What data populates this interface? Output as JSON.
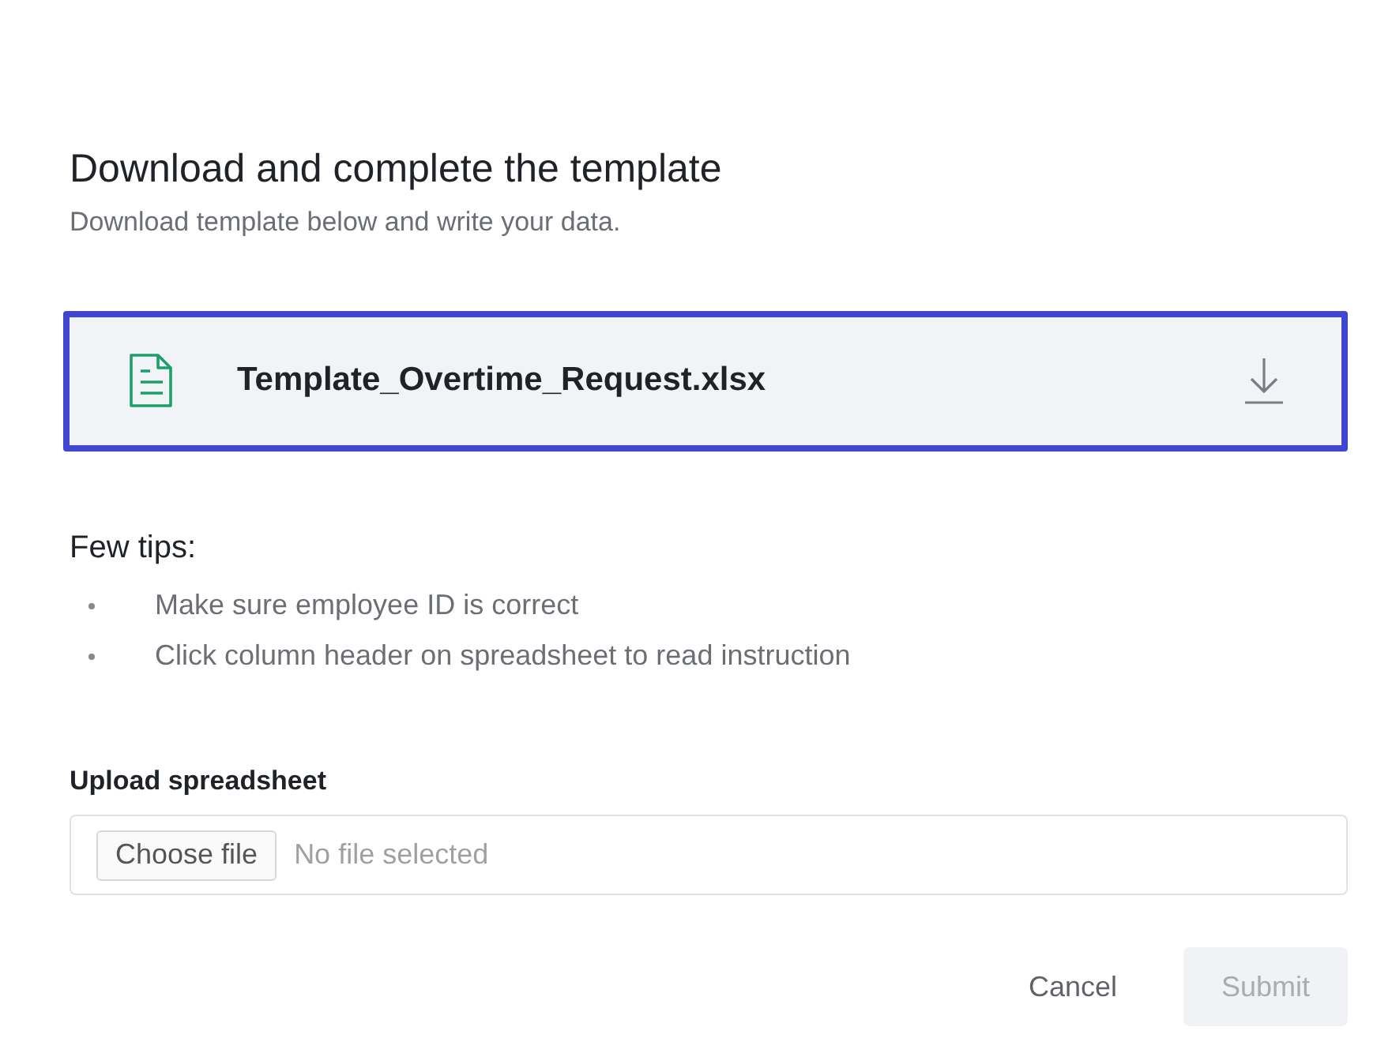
{
  "heading": "Download and complete the template",
  "subheading": "Download template below and write your data.",
  "template_file": {
    "name": "Template_Overtime_Request.xlsx",
    "focused": true
  },
  "tips": {
    "title": "Few tips:",
    "items": [
      "Make sure employee ID is correct",
      "Click column header on spreadsheet to read instruction"
    ]
  },
  "upload": {
    "label": "Upload spreadsheet",
    "button": "Choose file",
    "value": "No file selected"
  },
  "buttons": [
    {
      "label": "Cancel",
      "kind": "text",
      "disabled": false
    },
    {
      "label": "Submit",
      "kind": "primary",
      "disabled": true
    }
  ]
}
